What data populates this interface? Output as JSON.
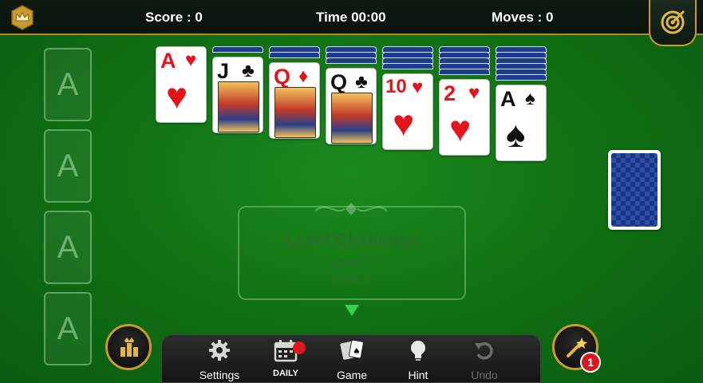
{
  "header": {
    "score_text": "Score : 0",
    "time_text": "Time 00:00",
    "moves_text": "Moves : 0"
  },
  "foundations": [
    "A",
    "A",
    "A",
    "A"
  ],
  "tableau": [
    {
      "rank": "A",
      "suit": "♥",
      "color": "#e3141b",
      "face_down": 0
    },
    {
      "rank": "J",
      "suit": "♣",
      "color": "#111111",
      "face_down": 1
    },
    {
      "rank": "Q",
      "suit": "♦",
      "color": "#e3141b",
      "face_down": 2
    },
    {
      "rank": "Q",
      "suit": "♣",
      "color": "#111111",
      "face_down": 3
    },
    {
      "rank": "10",
      "suit": "♥",
      "color": "#e3141b",
      "face_down": 4
    },
    {
      "rank": "2",
      "suit": "♥",
      "color": "#e3141b",
      "face_down": 5
    },
    {
      "rank": "A",
      "suit": "♠",
      "color": "#111111",
      "face_down": 6
    }
  ],
  "level_panel": {
    "title": "Level Challenge",
    "level": "Level 1",
    "draw": "Draw 1"
  },
  "toolbar": {
    "settings_label": "Settings",
    "daily_label": "DAILY",
    "game_label": "Game",
    "hint_label": "Hint",
    "undo_label": "Undo"
  },
  "magic_wand_count": "1",
  "colors": {
    "felt": "#12771a",
    "accent_gold": "#c79a2e",
    "card_back": "#1b3d8f",
    "notification_red": "#e0161c"
  }
}
